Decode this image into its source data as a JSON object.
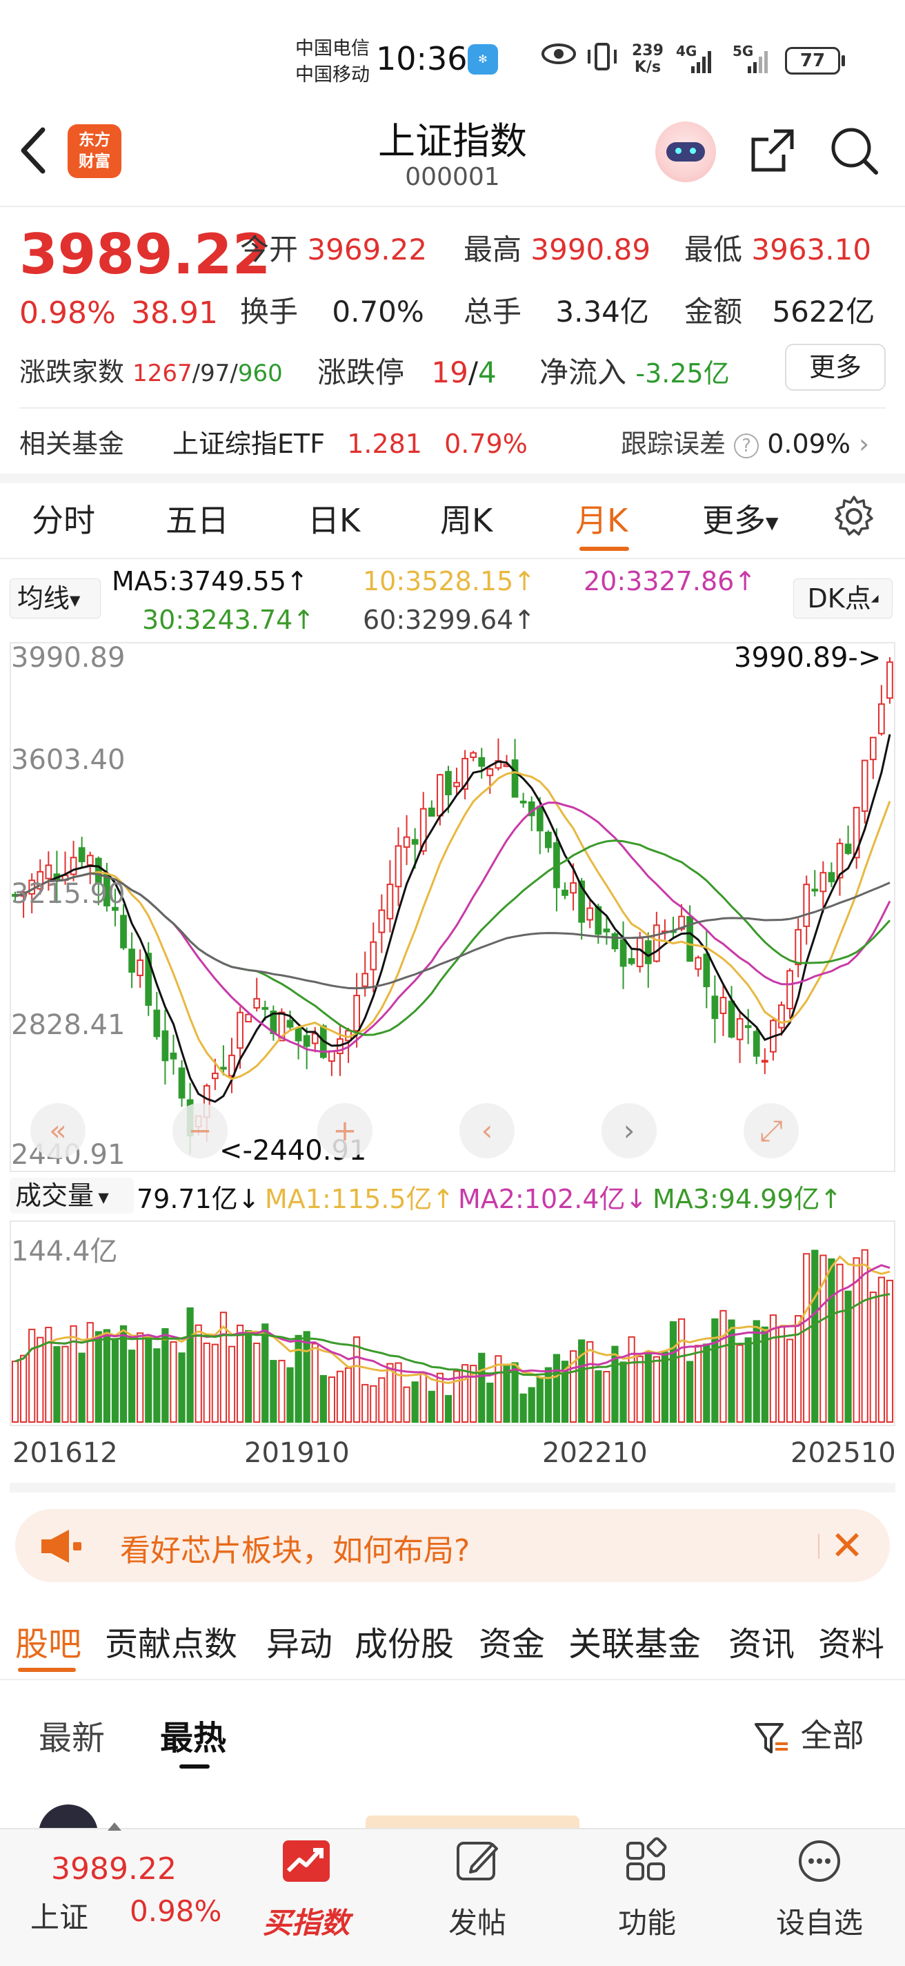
{
  "status_bar": {
    "carrier1": "中国电信",
    "carrier2": "中国移动",
    "time": "10:36",
    "speed_value": "239",
    "speed_unit": "K/s",
    "net1": "4G",
    "net2": "5G",
    "battery": "77"
  },
  "header": {
    "logo_line1": "东方",
    "logo_line2": "财富",
    "title": "上证指数",
    "code": "000001"
  },
  "quote": {
    "price": "3989.22",
    "change_pct": "0.98%",
    "change": "38.91",
    "open_label": "今开",
    "open": "3969.22",
    "high_label": "最高",
    "high": "3990.89",
    "low_label": "最低",
    "low": "3963.10",
    "turnover_label": "换手",
    "turnover": "0.70%",
    "volume_label": "总手",
    "volume": "3.34亿",
    "amount_label": "金额",
    "amount": "5622亿",
    "adv_label": "涨跌家数",
    "adv_up": "1267",
    "adv_sep1": "/",
    "adv_flat": "97",
    "adv_sep2": "/",
    "adv_down": "960",
    "limit_label": "涨跌停",
    "limit_up": "19",
    "limit_sep": "/",
    "limit_down": "4",
    "netflow_label": "净流入",
    "netflow": "-3.25亿",
    "more_button": "更多"
  },
  "fund": {
    "label": "相关基金",
    "name": "上证综指ETF",
    "price": "1.281",
    "pct": "0.79%",
    "tracking_label": "跟踪误差",
    "tracking_value": "0.09%"
  },
  "tabs": [
    "分时",
    "五日",
    "日K",
    "周K",
    "月K",
    "更多"
  ],
  "ma": {
    "selector": "均线",
    "ma5": "MA5:3749.55↑",
    "ma10": "10:3528.15↑",
    "ma20": "20:3327.86↑",
    "ma30": "30:3243.74↑",
    "ma60": "60:3299.64↑",
    "dk_button": "DK点"
  },
  "kline": {
    "y_labels": [
      "3990.89",
      "3603.40",
      "3215.90",
      "2828.41",
      "2440.91"
    ],
    "max_annotation": "3990.89->",
    "min_annotation": "<-2440.91"
  },
  "volume": {
    "selector": "成交量",
    "current": "79.71亿↓",
    "ma1": "MA1:115.5亿↑",
    "ma2": "MA2:102.4亿↓",
    "ma3": "MA3:94.99亿↑",
    "max_label": "144.4亿"
  },
  "x_labels": [
    "201612",
    "201910",
    "202210",
    "202510"
  ],
  "colors": {
    "up": "#e0312f",
    "down": "#2e9a2e",
    "accent": "#e86a1a",
    "ma5": "#111111",
    "ma10": "#e8b840",
    "ma20": "#c83aa8",
    "ma30": "#3a9a2a",
    "ma60": "#666666"
  },
  "promo": {
    "text": "看好芯片板块，如何布局?"
  },
  "section_tabs": [
    "股吧",
    "贡献点数",
    "异动",
    "成份股",
    "资金",
    "关联基金",
    "资讯",
    "资料"
  ],
  "sub_tabs": [
    "最新",
    "最热"
  ],
  "filter_label": "全部",
  "bottom_bar": {
    "price": "3989.22",
    "name": "上证",
    "pct": "0.98%",
    "items": [
      "买指数",
      "发帖",
      "功能",
      "设自选"
    ]
  }
}
